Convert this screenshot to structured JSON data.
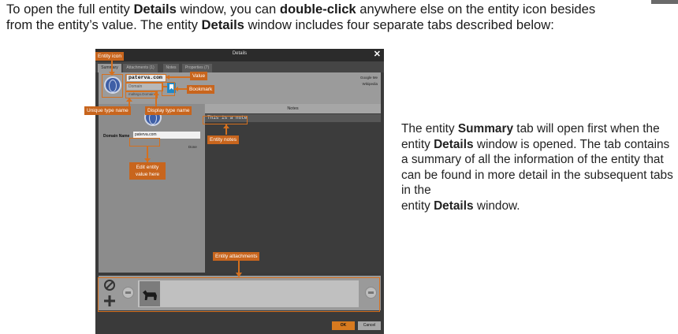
{
  "intro": {
    "l1a": "To open the full entity ",
    "l1b": "Details",
    "l1c": " window, you can ",
    "l1d": "double-click",
    "l1e": " anywhere else on the entity icon besides",
    "l2a": "from the entity’s value. The entity ",
    "l2b": "Details",
    "l2c": " window includes four separate tabs described below:"
  },
  "side": {
    "p1": "The entity ",
    "p2": "Summary",
    "p3": " tab will open first when the entity ",
    "p4": "Details",
    "p5": " window is opened. The tab contains a summary of all the information of the entity that can be found in more detail in the subsequent tabs in the",
    "p6": "entity ",
    "p7": "Details",
    "p8": " window."
  },
  "dialog": {
    "title": "Details",
    "close": "✕",
    "tabs": [
      "Summary",
      "Attachments (1)",
      "Notes",
      "Properties (7)"
    ],
    "value": "paterva.com",
    "display_type": "Domain",
    "unique_type": "maltego.Domain",
    "links": [
      "Google Me",
      "Wikipedia"
    ],
    "domain_label": "Domain Name",
    "domain_value": "paterva.com",
    "done": "Done",
    "notes_header": "Notes",
    "note_text": "This is a note",
    "ok": "OK",
    "cancel": "Cancel"
  },
  "callouts": {
    "entity_icon": "Entity icon",
    "value": "Value",
    "bookmark": "Bookmark",
    "unique_type_name": "Unique type name",
    "display_type_name": "Display type name",
    "entity_notes": "Entity notes",
    "edit_value": "Edit entity value here",
    "entity_attachments": "Entity attachments"
  },
  "colors": {
    "callout": "#c8651d",
    "bookmark": "#1e88c8",
    "ok_button": "#d87a1f"
  }
}
